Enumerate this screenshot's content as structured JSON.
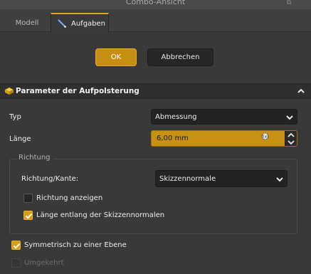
{
  "window": {
    "title": "Combo-Ansicht"
  },
  "tabs": [
    {
      "label": "Modell",
      "active": false
    },
    {
      "label": "Aufgaben",
      "active": true
    }
  ],
  "actions": {
    "ok_label": "OK",
    "cancel_label": "Abbrechen"
  },
  "section": {
    "title": "Parameter der Aufpolsterung"
  },
  "fields": {
    "type_label": "Typ",
    "type_value": "Abmessung",
    "length_label": "Länge",
    "length_value": "6,00 mm"
  },
  "direction": {
    "group_title": "Richtung",
    "edge_label": "Richtung/Kante:",
    "edge_value": "Skizzennormale",
    "show_direction_label": "Richtung anzeigen",
    "show_direction_checked": false,
    "along_normal_label": "Länge entlang der Skizzennormalen",
    "along_normal_checked": true
  },
  "options": {
    "symmetric_label": "Symmetrisch zu einer Ebene",
    "symmetric_checked": true,
    "reversed_label": "Umgekehrt",
    "reversed_checked": false,
    "reversed_enabled": false
  },
  "colors": {
    "accent": "#c68f14",
    "background": "#393939"
  }
}
